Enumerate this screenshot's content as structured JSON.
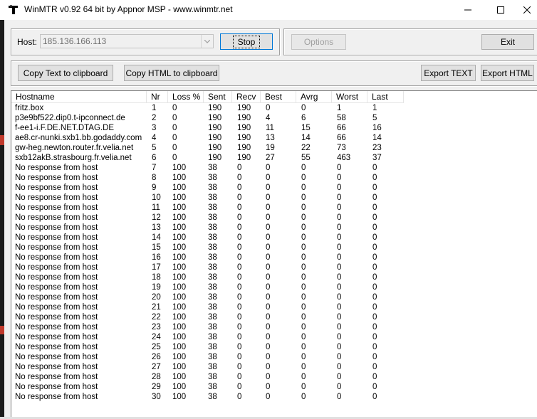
{
  "window": {
    "title": "WinMTR v0.92 64 bit by Appnor MSP - www.winmtr.net",
    "icon": "winmtr-app-icon",
    "controls": [
      "minimize-icon",
      "maximize-icon",
      "close-icon"
    ]
  },
  "host": {
    "label": "Host:",
    "value": "185.136.166.113"
  },
  "buttons": {
    "stop": "Stop",
    "options": "Options",
    "exit": "Exit",
    "copy_text": "Copy Text to clipboard",
    "copy_html": "Copy HTML to clipboard",
    "export_text": "Export TEXT",
    "export_html": "Export HTML"
  },
  "table": {
    "columns": [
      "Hostname",
      "Nr",
      "Loss %",
      "Sent",
      "Recv",
      "Best",
      "Avrg",
      "Worst",
      "Last"
    ],
    "rows": [
      [
        "fritz.box",
        "1",
        "0",
        "190",
        "190",
        "0",
        "0",
        "1",
        "1"
      ],
      [
        "p3e9bf522.dip0.t-ipconnect.de",
        "2",
        "0",
        "190",
        "190",
        "4",
        "6",
        "58",
        "5"
      ],
      [
        "f-ee1-i.F.DE.NET.DTAG.DE",
        "3",
        "0",
        "190",
        "190",
        "11",
        "15",
        "66",
        "16"
      ],
      [
        "ae8.cr-nunki.sxb1.bb.godaddy.com",
        "4",
        "0",
        "190",
        "190",
        "13",
        "14",
        "66",
        "14"
      ],
      [
        "gw-heg.newton.router.fr.velia.net",
        "5",
        "0",
        "190",
        "190",
        "19",
        "22",
        "73",
        "23"
      ],
      [
        "sxb12akB.strasbourg.fr.velia.net",
        "6",
        "0",
        "190",
        "190",
        "27",
        "55",
        "463",
        "37"
      ],
      [
        "No response from host",
        "7",
        "100",
        "38",
        "0",
        "0",
        "0",
        "0",
        "0"
      ],
      [
        "No response from host",
        "8",
        "100",
        "38",
        "0",
        "0",
        "0",
        "0",
        "0"
      ],
      [
        "No response from host",
        "9",
        "100",
        "38",
        "0",
        "0",
        "0",
        "0",
        "0"
      ],
      [
        "No response from host",
        "10",
        "100",
        "38",
        "0",
        "0",
        "0",
        "0",
        "0"
      ],
      [
        "No response from host",
        "11",
        "100",
        "38",
        "0",
        "0",
        "0",
        "0",
        "0"
      ],
      [
        "No response from host",
        "12",
        "100",
        "38",
        "0",
        "0",
        "0",
        "0",
        "0"
      ],
      [
        "No response from host",
        "13",
        "100",
        "38",
        "0",
        "0",
        "0",
        "0",
        "0"
      ],
      [
        "No response from host",
        "14",
        "100",
        "38",
        "0",
        "0",
        "0",
        "0",
        "0"
      ],
      [
        "No response from host",
        "15",
        "100",
        "38",
        "0",
        "0",
        "0",
        "0",
        "0"
      ],
      [
        "No response from host",
        "16",
        "100",
        "38",
        "0",
        "0",
        "0",
        "0",
        "0"
      ],
      [
        "No response from host",
        "17",
        "100",
        "38",
        "0",
        "0",
        "0",
        "0",
        "0"
      ],
      [
        "No response from host",
        "18",
        "100",
        "38",
        "0",
        "0",
        "0",
        "0",
        "0"
      ],
      [
        "No response from host",
        "19",
        "100",
        "38",
        "0",
        "0",
        "0",
        "0",
        "0"
      ],
      [
        "No response from host",
        "20",
        "100",
        "38",
        "0",
        "0",
        "0",
        "0",
        "0"
      ],
      [
        "No response from host",
        "21",
        "100",
        "38",
        "0",
        "0",
        "0",
        "0",
        "0"
      ],
      [
        "No response from host",
        "22",
        "100",
        "38",
        "0",
        "0",
        "0",
        "0",
        "0"
      ],
      [
        "No response from host",
        "23",
        "100",
        "38",
        "0",
        "0",
        "0",
        "0",
        "0"
      ],
      [
        "No response from host",
        "24",
        "100",
        "38",
        "0",
        "0",
        "0",
        "0",
        "0"
      ],
      [
        "No response from host",
        "25",
        "100",
        "38",
        "0",
        "0",
        "0",
        "0",
        "0"
      ],
      [
        "No response from host",
        "26",
        "100",
        "38",
        "0",
        "0",
        "0",
        "0",
        "0"
      ],
      [
        "No response from host",
        "27",
        "100",
        "38",
        "0",
        "0",
        "0",
        "0",
        "0"
      ],
      [
        "No response from host",
        "28",
        "100",
        "38",
        "0",
        "0",
        "0",
        "0",
        "0"
      ],
      [
        "No response from host",
        "29",
        "100",
        "38",
        "0",
        "0",
        "0",
        "0",
        "0"
      ],
      [
        "No response from host",
        "30",
        "100",
        "38",
        "0",
        "0",
        "0",
        "0",
        "0"
      ]
    ]
  },
  "colors": {
    "accent": "#0078d7",
    "window_bg": "#f0f0f0",
    "list_bg": "#ffffff"
  }
}
